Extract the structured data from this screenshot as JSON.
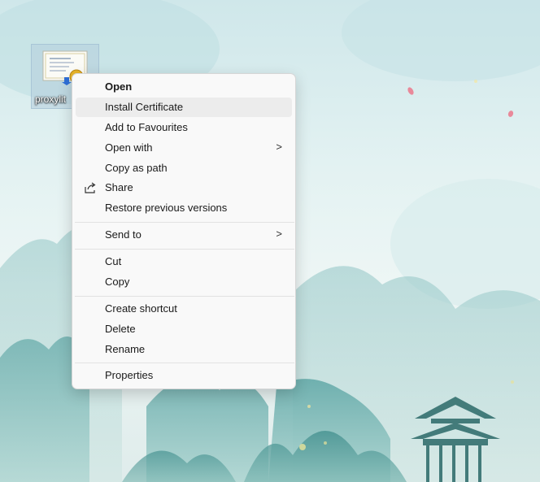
{
  "desktop": {
    "icon_label": "proxylit"
  },
  "menu": {
    "items": [
      {
        "label": "Open",
        "bold": true
      },
      {
        "label": "Install Certificate",
        "highlighted": true
      },
      {
        "label": "Add to Favourites"
      },
      {
        "label": "Open with",
        "submenu": ">"
      },
      {
        "label": "Copy as path"
      },
      {
        "label": "Share",
        "icon": "share-icon"
      },
      {
        "label": "Restore previous versions"
      },
      {
        "label": "Send to",
        "submenu": ">"
      },
      {
        "label": "Cut"
      },
      {
        "label": "Copy"
      },
      {
        "label": "Create shortcut"
      },
      {
        "label": "Delete"
      },
      {
        "label": "Rename"
      },
      {
        "label": "Properties"
      }
    ]
  },
  "colors": {
    "menu_bg": "#f9f9f9",
    "highlight": "#ececec",
    "separator": "#e2e2e2",
    "wallpaper_sky": "#cfe7ea"
  }
}
